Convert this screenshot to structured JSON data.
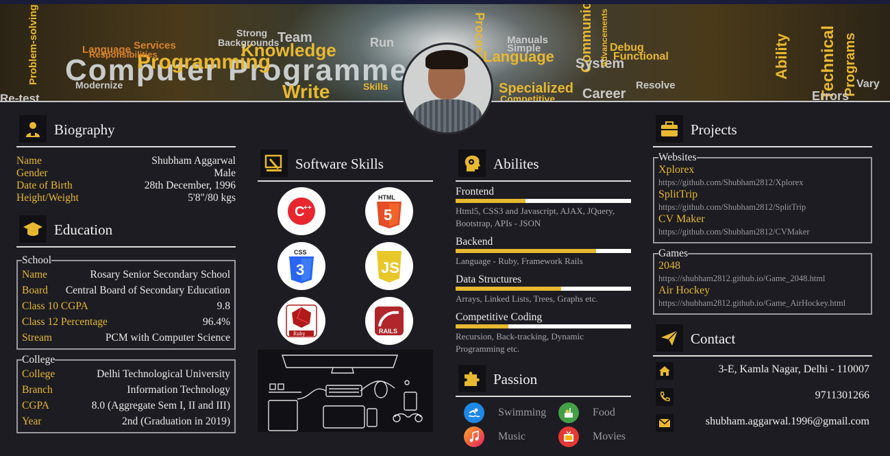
{
  "banner": {
    "words": [
      "Computer Programmer",
      "Programming",
      "Knowledge",
      "Team",
      "Strong",
      "Backgrounds",
      "Services",
      "Language",
      "Responsibilities",
      "Problem-solving",
      "Modernize",
      "Re-test",
      "Write",
      "Skills",
      "Process",
      "Manuals",
      "Simple",
      "Communicate",
      "Language",
      "System",
      "Debug",
      "Functional",
      "Technical",
      "Ability",
      "Specialized",
      "Resolve",
      "Career",
      "Competitive",
      "Programs",
      "Errors",
      "Vary",
      "Advancements",
      "Run"
    ],
    "profile_photo_alt": "Profile photo"
  },
  "biography": {
    "title": "Biography",
    "icon": "person-icon",
    "rows": [
      {
        "key": "Name",
        "value": "Shubham Aggarwal"
      },
      {
        "key": "Gender",
        "value": "Male"
      },
      {
        "key": "Date of Birth",
        "value": "28th December, 1996"
      },
      {
        "key": "Height/Weight",
        "value": "5'8\"/80 kgs"
      }
    ]
  },
  "education": {
    "title": "Education",
    "icon": "graduation-cap-icon",
    "school": {
      "legend": "School",
      "rows": [
        {
          "key": "Name",
          "value": "Rosary Senior Secondary School"
        },
        {
          "key": "Board",
          "value": "Central Board of Secondary Education"
        },
        {
          "key": "Class 10 CGPA",
          "value": "9.8"
        },
        {
          "key": "Class 12 Percentage",
          "value": "96.4%"
        },
        {
          "key": "Stream",
          "value": "PCM with Computer Science"
        }
      ]
    },
    "college": {
      "legend": "College",
      "rows": [
        {
          "key": "College",
          "value": "Delhi Technological University"
        },
        {
          "key": "Branch",
          "value": "Information Technology"
        },
        {
          "key": "CGPA",
          "value": "8.0 (Aggregate Sem I, II and III)"
        },
        {
          "key": "Year",
          "value": "2nd (Graduation in 2019)"
        }
      ]
    }
  },
  "software_skills": {
    "title": "Software Skills",
    "icon": "design-tools-icon",
    "items": [
      {
        "name": "C++",
        "icon": "cpp-logo-icon",
        "color": "#e8262d"
      },
      {
        "name": "HTML5",
        "icon": "html5-logo-icon",
        "color": "#e44d26"
      },
      {
        "name": "CSS3",
        "icon": "css3-logo-icon",
        "color": "#2965f1"
      },
      {
        "name": "JS",
        "icon": "javascript-logo-icon",
        "color": "#e8c72a"
      },
      {
        "name": "Ruby",
        "icon": "ruby-logo-icon",
        "color": "#b01a1a"
      },
      {
        "name": "RAILS",
        "icon": "rails-logo-icon",
        "color": "#b0262a"
      }
    ],
    "illustration": "workspace-devices-illustration"
  },
  "abilities": {
    "title": "Abilites",
    "icon": "head-gears-icon",
    "items": [
      {
        "label": "Frontend",
        "level": 0.4,
        "desc": "Html5, CSS3 and Javascript, AJAX, JQuery, Bootstrap, APIs - JSON"
      },
      {
        "label": "Backend",
        "level": 0.8,
        "desc": "Language - Ruby, Framework Rails"
      },
      {
        "label": "Data Structures",
        "level": 0.6,
        "desc": "Arrays, Linked Lists, Trees, Graphs etc."
      },
      {
        "label": "Competitive Coding",
        "level": 0.3,
        "desc": "Recursion, Back-tracking, Dynamic Programming etc."
      }
    ]
  },
  "passion": {
    "title": "Passion",
    "icon": "puzzle-icon",
    "items": [
      {
        "label": "Swimming",
        "icon": "swimming-icon",
        "color": "#1e88e5"
      },
      {
        "label": "Food",
        "icon": "food-icon",
        "color": "#43a047"
      },
      {
        "label": "Music",
        "icon": "music-icon",
        "color": "#f57c00"
      },
      {
        "label": "Movies",
        "icon": "movies-icon",
        "color": "#e53935"
      }
    ]
  },
  "projects": {
    "title": "Projects",
    "icon": "briefcase-icon",
    "websites": {
      "legend": "Websites",
      "items": [
        {
          "name": "Xplorex",
          "url": "https://github.com/Shubham2812/Xplorex"
        },
        {
          "name": "SplitTrip",
          "url": "https://github.com/Shubham2812/SplitTrip"
        },
        {
          "name": "CV Maker",
          "url": "https://github.com/Shubham2812/CVMaker"
        }
      ]
    },
    "games": {
      "legend": "Games",
      "items": [
        {
          "name": "2048",
          "url": "https://shubham2812.github.io/Game_2048.html"
        },
        {
          "name": "Air Hockey",
          "url": "https://shubham2812.github.io/Game_AirHockey.html"
        }
      ]
    }
  },
  "contact": {
    "title": "Contact",
    "icon": "paper-plane-icon",
    "address": "3-E, Kamla Nagar, Delhi - 110007",
    "phone": "9711301266",
    "email": "shubham.aggarwal.1996@gmail.com"
  },
  "colors": {
    "accent": "#e8b830",
    "background": "#1c1c22",
    "muted": "#9a9aa0"
  }
}
